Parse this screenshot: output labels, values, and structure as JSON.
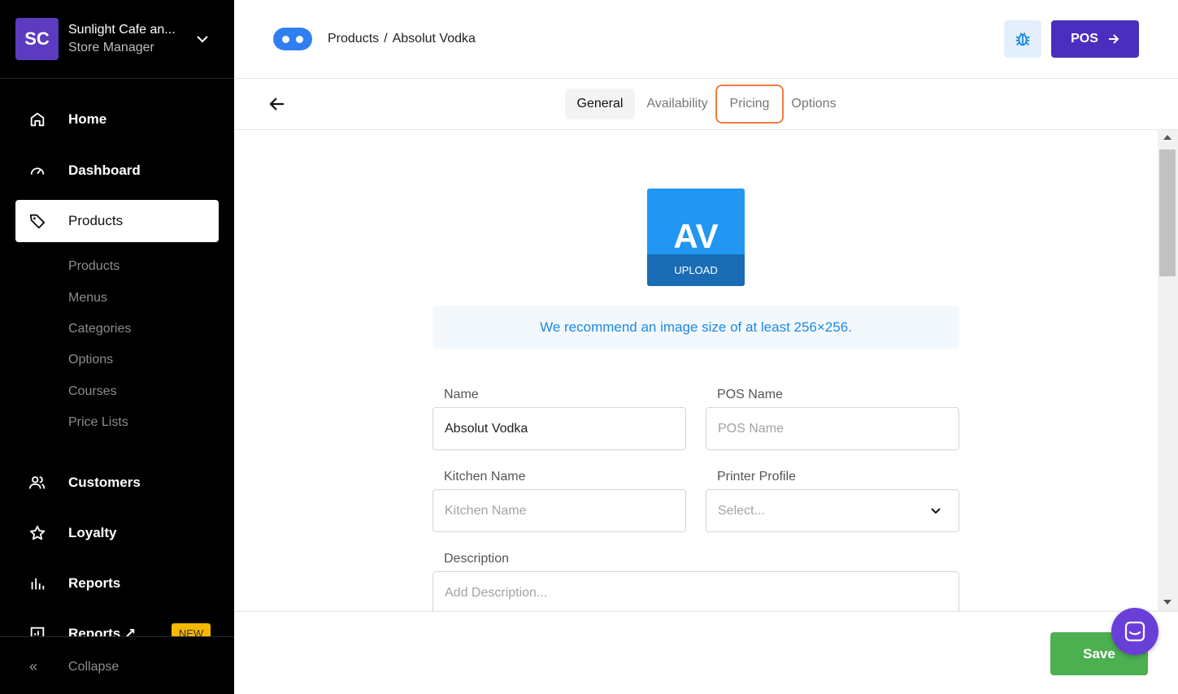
{
  "store": {
    "initials": "SC",
    "name": "Sunlight Cafe an...",
    "role": "Store Manager"
  },
  "nav": {
    "home": "Home",
    "dashboard": "Dashboard",
    "products": "Products",
    "customers": "Customers",
    "loyalty": "Loyalty",
    "reports": "Reports",
    "reports_external": "Reports ↗",
    "new_badge": "NEW",
    "collapse": "Collapse"
  },
  "subnav": [
    "Products",
    "Menus",
    "Categories",
    "Options",
    "Courses",
    "Price Lists"
  ],
  "header": {
    "breadcrumb_root": "Products",
    "breadcrumb_sep": "/",
    "breadcrumb_current": "Absolut Vodka",
    "pos_label": "POS"
  },
  "tabs": {
    "general": "General",
    "availability": "Availability",
    "pricing": "Pricing",
    "options": "Options"
  },
  "image": {
    "initials": "AV",
    "upload_label": "UPLOAD",
    "hint": "We recommend an image size of at least 256×256."
  },
  "form": {
    "name_label": "Name",
    "name_value": "Absolut Vodka",
    "pos_name_label": "POS Name",
    "pos_name_placeholder": "POS Name",
    "kitchen_name_label": "Kitchen Name",
    "kitchen_name_placeholder": "Kitchen Name",
    "printer_profile_label": "Printer Profile",
    "printer_profile_placeholder": "Select...",
    "description_label": "Description",
    "description_placeholder": "Add Description..."
  },
  "footer": {
    "save_label": "Save"
  },
  "colors": {
    "accent": "#4a2fbf",
    "save": "#4caf50",
    "highlight": "#f07a3e",
    "hint_text": "#1e88e5"
  }
}
